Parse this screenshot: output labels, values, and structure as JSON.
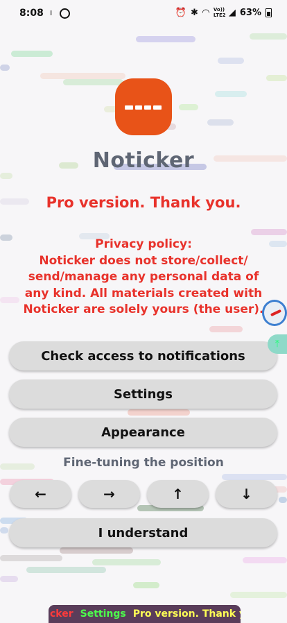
{
  "status_bar": {
    "time": "8:08",
    "indicator": "ı",
    "network_label": "Vo)) LTE2",
    "battery": "63%",
    "icons": [
      "alarm-icon",
      "bluetooth-icon",
      "wifi-icon",
      "signal-icon",
      "battery-icon"
    ]
  },
  "app": {
    "logo_icon": "ticker-logo-icon",
    "logo_color": "#e85318",
    "title": "Noticker",
    "pro_text": "Pro version. Thank you.",
    "privacy_title": "Privacy policy:",
    "privacy_body": "Noticker does not store/collect/ send/manage any personal data of any kind. All materials created with Noticker are solely yours (the user)."
  },
  "buttons": {
    "check_access": "Check access to notifications",
    "settings": "Settings",
    "appearance": "Appearance",
    "understand": "I understand"
  },
  "fine_tuning": {
    "label": "Fine-tuning the position",
    "left": "←",
    "right": "→",
    "up": "↑",
    "down": "↓"
  },
  "ticker": {
    "items": [
      "cker",
      "Settings",
      "Pro version. Thank you."
    ],
    "colors": [
      "#ff3b3b",
      "#4cff4c",
      "#ffff55"
    ]
  },
  "colors": {
    "accent_red": "#e8322b",
    "title_gray": "#5f6674",
    "button_bg": "#dcdcdc"
  }
}
